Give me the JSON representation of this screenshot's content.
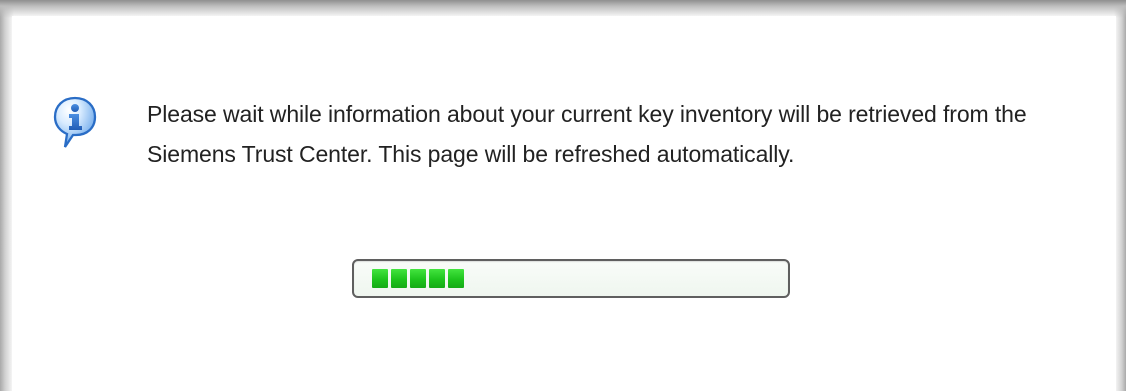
{
  "dialog": {
    "message": "Please wait while information about your current key inventory will be retrieved from the Siemens Trust Center. This page will be refreshed automatically.",
    "icon": "info-icon"
  },
  "progress": {
    "value_fraction": 0.24,
    "visible_blocks": 5,
    "bar_color": "#1ec41d",
    "track_color": "#f2f8f2"
  },
  "colors": {
    "text": "#222222",
    "border": "#5f5f5f",
    "icon_blue": "#2e73c9"
  }
}
